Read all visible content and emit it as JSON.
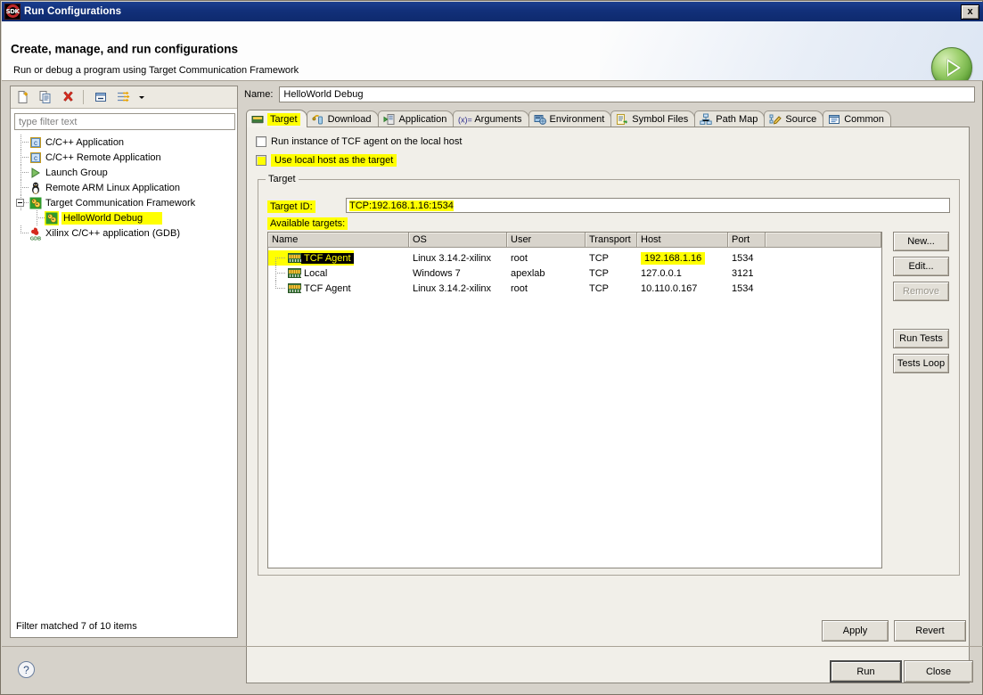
{
  "window": {
    "title": "Run Configurations",
    "icon": "sdk-icon",
    "close_label": "✕"
  },
  "header": {
    "title": "Create, manage, and run configurations",
    "subtitle": "Run or debug a program using Target Communication Framework",
    "badge_icon": "run-play-icon"
  },
  "left_panel": {
    "toolbar": [
      {
        "name": "new-configuration-icon"
      },
      {
        "name": "duplicate-configuration-icon"
      },
      {
        "name": "delete-configuration-icon"
      },
      {
        "name": "collapse-all-icon"
      },
      {
        "name": "filter-icon"
      },
      {
        "name": "view-menu-chevron-icon"
      }
    ],
    "filter": {
      "placeholder": "type filter text",
      "value": ""
    },
    "tree": [
      {
        "label": "C/C++ Application",
        "icon": "c-app-icon",
        "indent": 0,
        "expander": false,
        "highlighted": false
      },
      {
        "label": "C/C++ Remote Application",
        "icon": "c-app-icon",
        "indent": 0,
        "expander": false,
        "highlighted": false
      },
      {
        "label": "Launch Group",
        "icon": "launch-group-icon",
        "indent": 0,
        "expander": false,
        "highlighted": false
      },
      {
        "label": "Remote ARM Linux Application",
        "icon": "linux-penguin-icon",
        "indent": 0,
        "expander": false,
        "highlighted": false
      },
      {
        "label": "Target Communication Framework",
        "icon": "tcf-icon",
        "indent": 0,
        "expander": true,
        "highlighted": false
      },
      {
        "label": "HelloWorld Debug",
        "icon": "tcf-icon",
        "indent": 1,
        "expander": false,
        "highlighted": true
      },
      {
        "label": "Xilinx C/C++ application (GDB)",
        "icon": "gdb-icon",
        "indent": 0,
        "expander": false,
        "highlighted": false
      }
    ],
    "status": "Filter matched 7 of 10 items"
  },
  "config": {
    "name_label": "Name:",
    "name_value": "HelloWorld Debug",
    "tabs": [
      {
        "label": "Target",
        "icon": "chip-icon",
        "active": true,
        "highlighted": true
      },
      {
        "label": "Download",
        "icon": "download-icon",
        "active": false,
        "highlighted": false
      },
      {
        "label": "Application",
        "icon": "application-icon",
        "active": false,
        "highlighted": false
      },
      {
        "label": "Arguments",
        "icon": "arguments-icon",
        "active": false,
        "highlighted": false
      },
      {
        "label": "Environment",
        "icon": "environment-icon",
        "active": false,
        "highlighted": false
      },
      {
        "label": "Symbol Files",
        "icon": "symbol-files-icon",
        "active": false,
        "highlighted": false
      },
      {
        "label": "Path Map",
        "icon": "path-map-icon",
        "active": false,
        "highlighted": false
      },
      {
        "label": "Source",
        "icon": "source-icon",
        "active": false,
        "highlighted": false
      },
      {
        "label": "Common",
        "icon": "common-icon",
        "active": false,
        "highlighted": false
      }
    ],
    "checkboxes": [
      {
        "label": "Run instance of TCF agent on the local host",
        "checked": false,
        "highlighted": false
      },
      {
        "label": "Use local host as the target",
        "checked": false,
        "highlighted": true
      }
    ],
    "target_group": {
      "legend": "Target",
      "target_id_label": "Target ID:",
      "target_id_value": "TCP:192.168.1.16:1534",
      "available_label": "Available targets:",
      "columns": [
        "Name",
        "OS",
        "User",
        "Transport",
        "Host",
        "Port"
      ],
      "rows": [
        {
          "name": "TCF Agent",
          "os": "Linux 3.14.2-xilinx",
          "user": "root",
          "transport": "TCP",
          "host": "192.168.1.16",
          "port": "1534",
          "selected": true,
          "host_highlighted": true
        },
        {
          "name": "Local",
          "os": "Windows 7",
          "user": "apexlab",
          "transport": "TCP",
          "host": "127.0.0.1",
          "port": "3121",
          "selected": false,
          "host_highlighted": false
        },
        {
          "name": "TCF Agent",
          "os": "Linux 3.14.2-xilinx",
          "user": "root",
          "transport": "TCP",
          "host": "10.110.0.167",
          "port": "1534",
          "selected": false,
          "host_highlighted": false
        }
      ],
      "side_buttons": [
        {
          "label": "New...",
          "enabled": true
        },
        {
          "label": "Edit...",
          "enabled": true
        },
        {
          "label": "Remove",
          "enabled": false
        },
        {
          "label": "Run Tests",
          "enabled": true
        },
        {
          "label": "Tests Loop",
          "enabled": true
        }
      ]
    },
    "apply_label": "Apply",
    "revert_label": "Revert"
  },
  "footer": {
    "help_icon": "help-question-icon",
    "run_label": "Run",
    "close_label": "Close"
  },
  "colors": {
    "highlight": "#ffff00",
    "titlebar": "#12307a",
    "dialog_bg": "#d6d2ca",
    "selection_bg": "#000000",
    "selection_fg": "#ffff00"
  }
}
